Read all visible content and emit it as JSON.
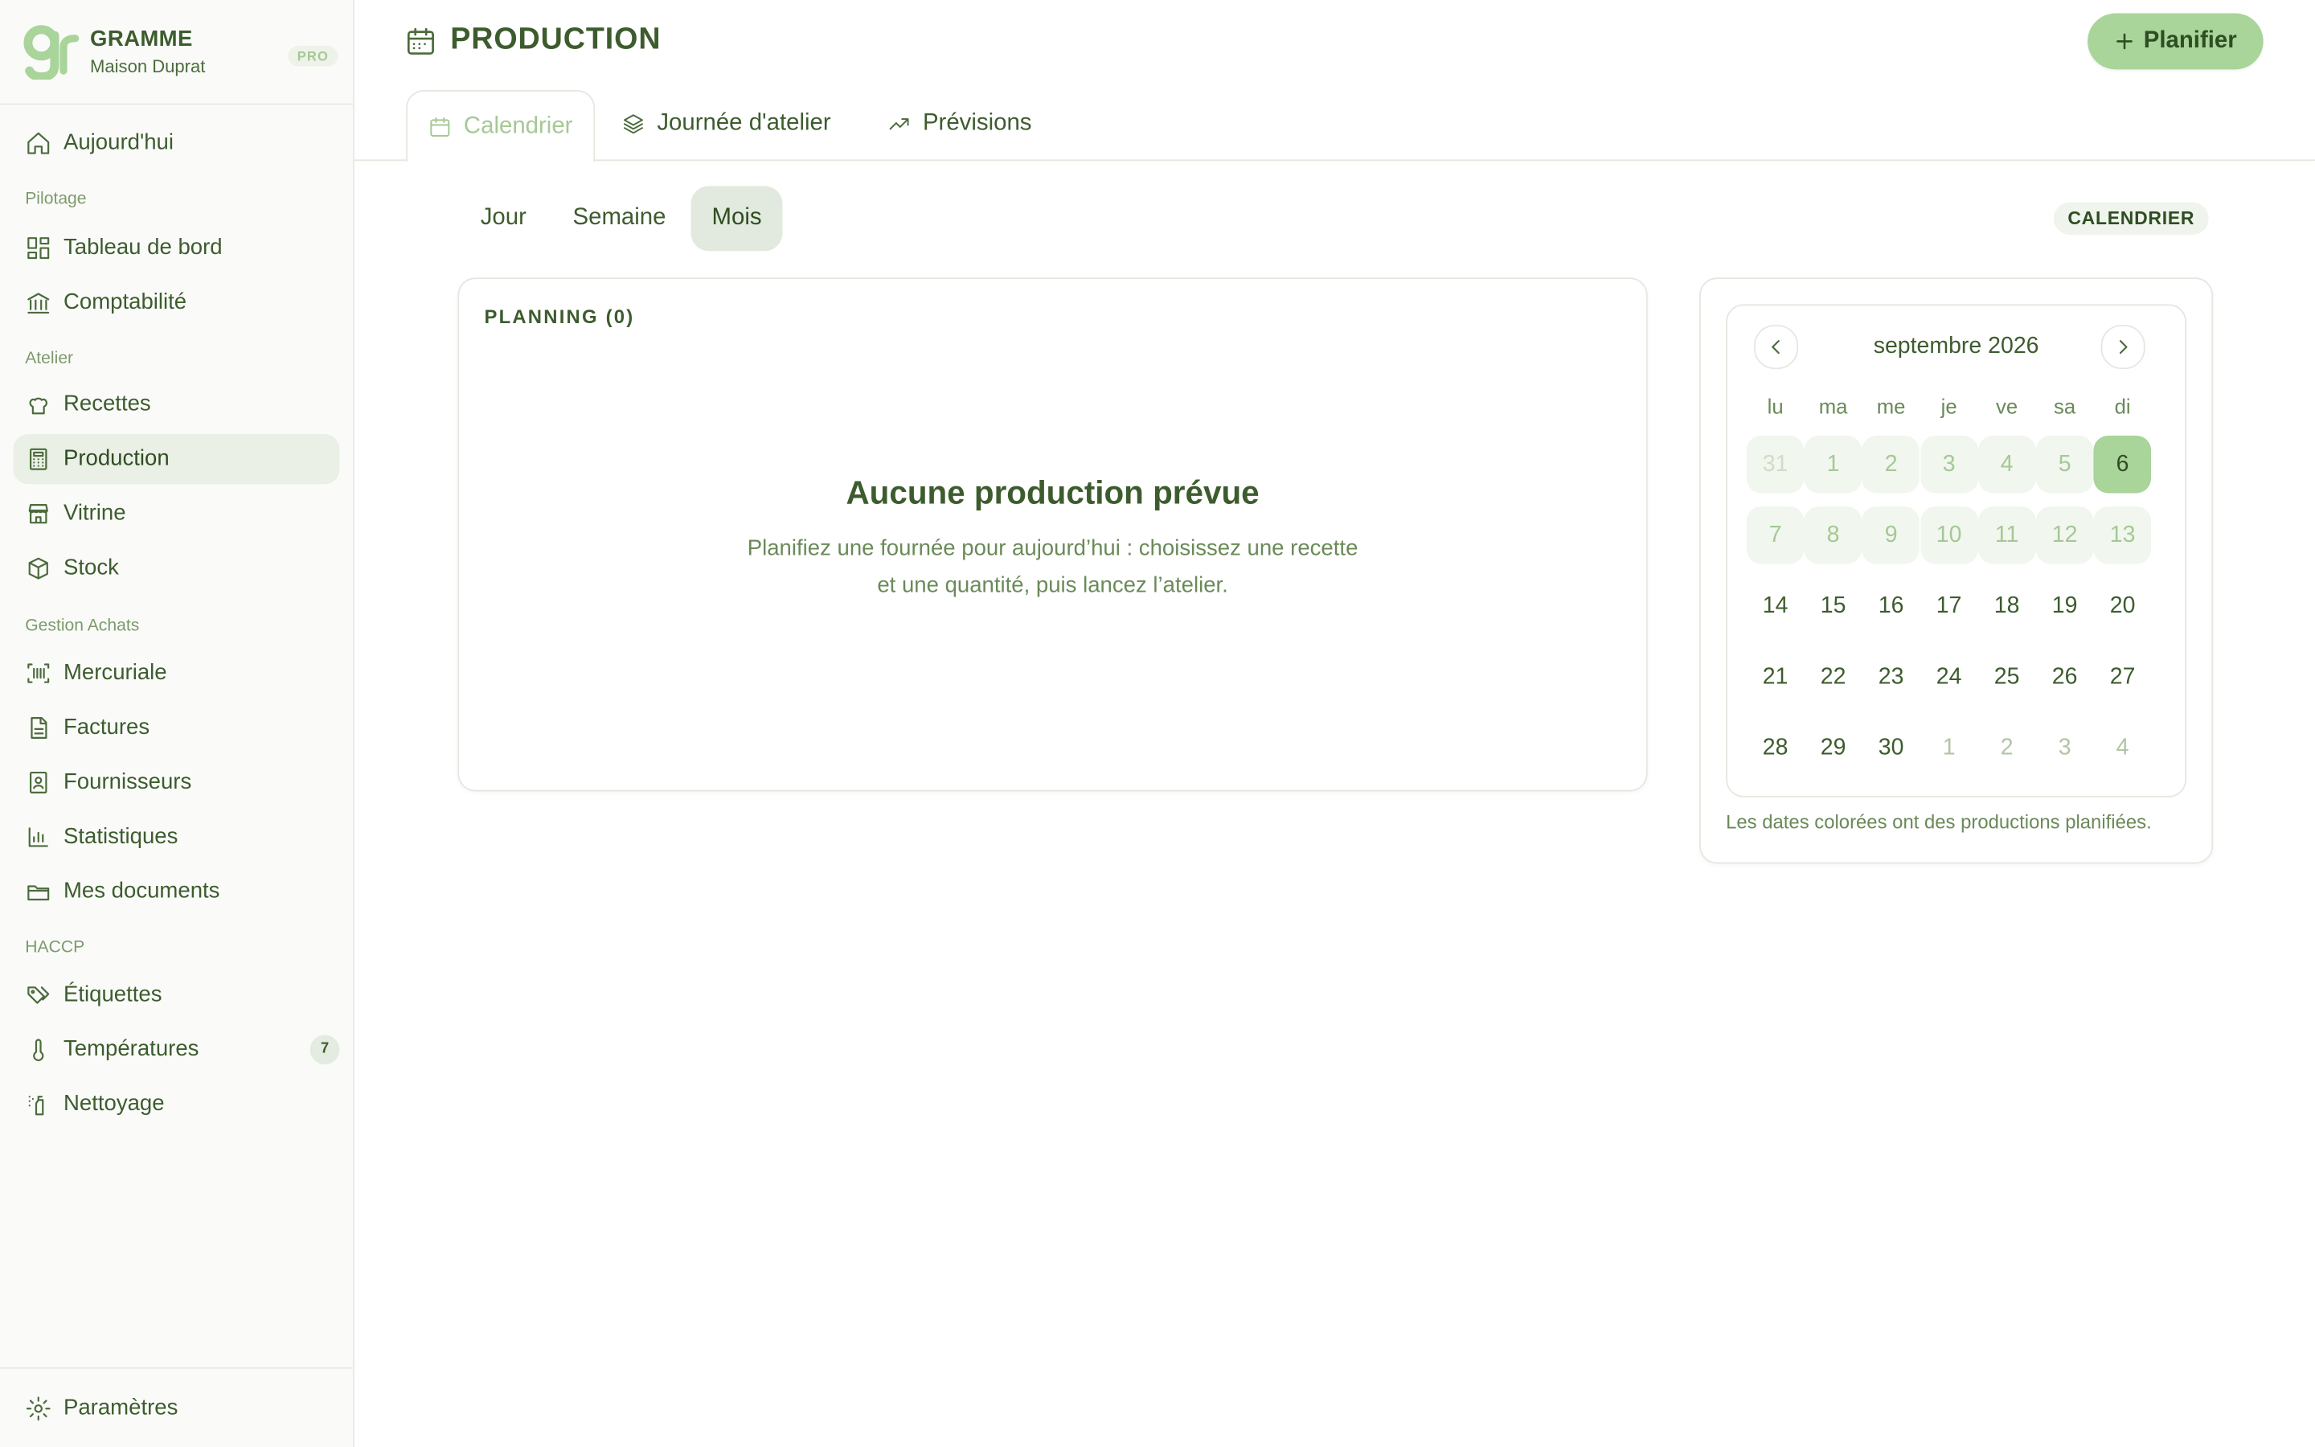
{
  "brand": {
    "name": "GRAMME",
    "subtitle": "Maison Duprat",
    "plan": "PRO"
  },
  "nav": {
    "today": "Aujourd'hui",
    "sections": [
      "Pilotage",
      "Atelier",
      "Gestion Achats",
      "HACCP"
    ],
    "items": [
      {
        "label": "Tableau de bord",
        "icon": "dashboard-icon"
      },
      {
        "label": "Comptabilité",
        "icon": "bank-icon"
      },
      {
        "label": "Recettes",
        "icon": "chef-hat-icon"
      },
      {
        "label": "Production",
        "icon": "calculator-icon",
        "active": true
      },
      {
        "label": "Vitrine",
        "icon": "store-icon"
      },
      {
        "label": "Stock",
        "icon": "box-icon"
      },
      {
        "label": "Mercuriale",
        "icon": "barcode-icon"
      },
      {
        "label": "Factures",
        "icon": "document-icon"
      },
      {
        "label": "Fournisseurs",
        "icon": "supplier-icon"
      },
      {
        "label": "Statistiques",
        "icon": "bar-chart-icon"
      },
      {
        "label": "Mes documents",
        "icon": "folder-icon"
      },
      {
        "label": "Étiquettes",
        "icon": "tags-icon"
      },
      {
        "label": "Températures",
        "icon": "thermometer-icon",
        "badge": "7"
      },
      {
        "label": "Nettoyage",
        "icon": "spray-icon"
      }
    ],
    "settings": "Paramètres"
  },
  "header": {
    "title": "PRODUCTION",
    "plan_button": "Planifier"
  },
  "tabs": [
    {
      "label": "Calendrier",
      "active": true
    },
    {
      "label": "Journée d'atelier"
    },
    {
      "label": "Prévisions"
    }
  ],
  "views": [
    "Jour",
    "Semaine",
    "Mois"
  ],
  "active_view": "Mois",
  "calendar_chip": "CALENDRIER",
  "planning": {
    "title": "PLANNING (0)",
    "empty_title": "Aucune production prévue",
    "empty_text": "Planifiez une fournée pour aujourd’hui : choisissez une recette et une quantité, puis lancez l’atelier."
  },
  "calendar": {
    "month": "septembre 2026",
    "weekdays": [
      "lu",
      "ma",
      "me",
      "je",
      "ve",
      "sa",
      "di"
    ],
    "weeks": [
      [
        "31",
        "1",
        "2",
        "3",
        "4",
        "5",
        "6"
      ],
      [
        "7",
        "8",
        "9",
        "10",
        "11",
        "12",
        "13"
      ],
      [
        "14",
        "15",
        "16",
        "17",
        "18",
        "19",
        "20"
      ],
      [
        "21",
        "22",
        "23",
        "24",
        "25",
        "26",
        "27"
      ],
      [
        "28",
        "29",
        "30",
        "1",
        "2",
        "3",
        "4"
      ]
    ],
    "selected": "6",
    "note": "Les dates colorées ont des productions planifiées.",
    "colors": {
      "accent": "#a9d49a",
      "planned": "#f1f6ee"
    }
  }
}
